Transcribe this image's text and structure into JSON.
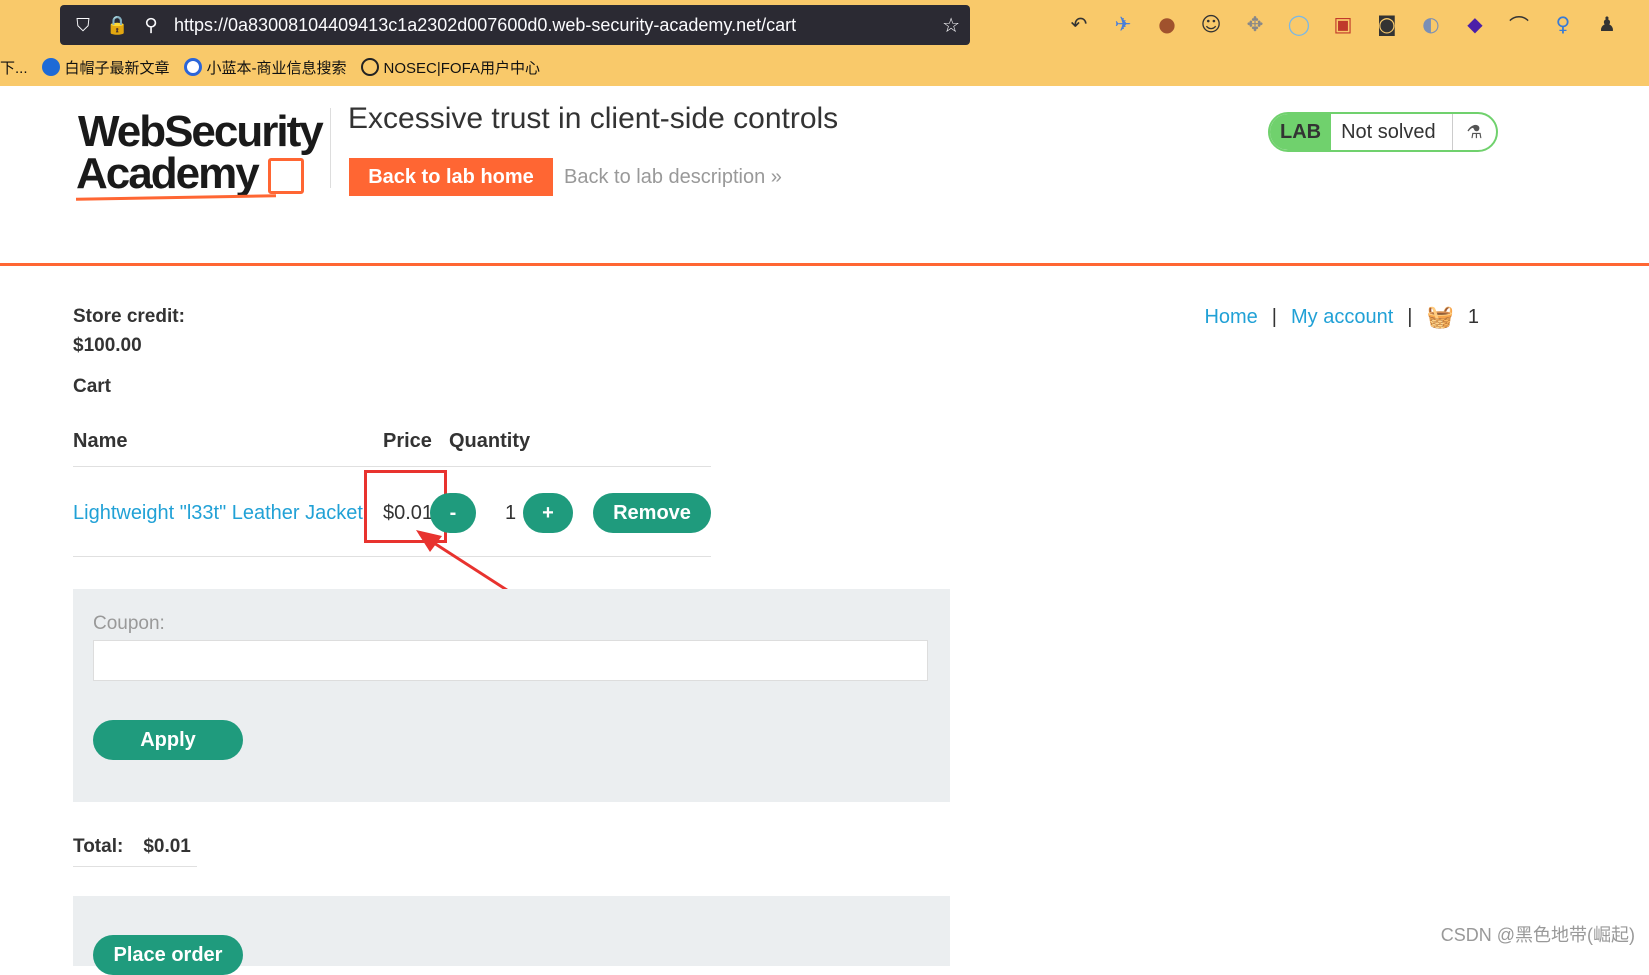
{
  "browser": {
    "url": "https://0a83008104409413c1a2302d007600d0.web-security-academy.net/cart",
    "bookmarks": [
      {
        "label": "下...",
        "color": "transparent"
      },
      {
        "label": "白帽子最新文章",
        "color": "#1e6ad6"
      },
      {
        "label": "小蓝本-商业信息搜索",
        "color": "#2b65d9"
      },
      {
        "label": "NOSEC|FOFA用户中心",
        "color": "transparent"
      }
    ],
    "extensions": [
      "back-arrow-icon",
      "bird-icon",
      "cookie-icon",
      "cookie-face-icon",
      "puzzle-icon",
      "ring-icon",
      "gear-square-icon",
      "mask-icon",
      "toggle-icon",
      "diamond-icon",
      "hat-icon",
      "key-icon",
      "spy-icon"
    ]
  },
  "lab": {
    "logo_line1": "WebSecurity",
    "logo_line2": "Academy",
    "title": "Excessive trust in client-side controls",
    "back_home": "Back to lab home",
    "back_desc": "Back to lab description",
    "status_badge": "LAB",
    "status_text": "Not solved"
  },
  "nav": {
    "home": "Home",
    "account": "My account",
    "cart_count": "1"
  },
  "store": {
    "credit_label": "Store credit:",
    "credit_value": "$100.00",
    "cart_label": "Cart"
  },
  "table": {
    "headers": [
      "Name",
      "Price",
      "Quantity"
    ],
    "rows": [
      {
        "name": "Lightweight \"l33t\" Leather Jacket",
        "price": "$0.01",
        "qty": "1"
      }
    ],
    "minus": "-",
    "plus": "+",
    "remove": "Remove"
  },
  "coupon": {
    "label": "Coupon:",
    "value": "",
    "apply": "Apply"
  },
  "total": {
    "label": "Total:",
    "value": "$0.01"
  },
  "order": {
    "place": "Place order"
  },
  "colors": {
    "accent": "#ff6633",
    "button": "#1f9b7d",
    "link": "#21a1d6",
    "lab_green": "#70d16d",
    "highlight": "#e8332f"
  },
  "watermark": "CSDN @黑色地带(崛起)"
}
